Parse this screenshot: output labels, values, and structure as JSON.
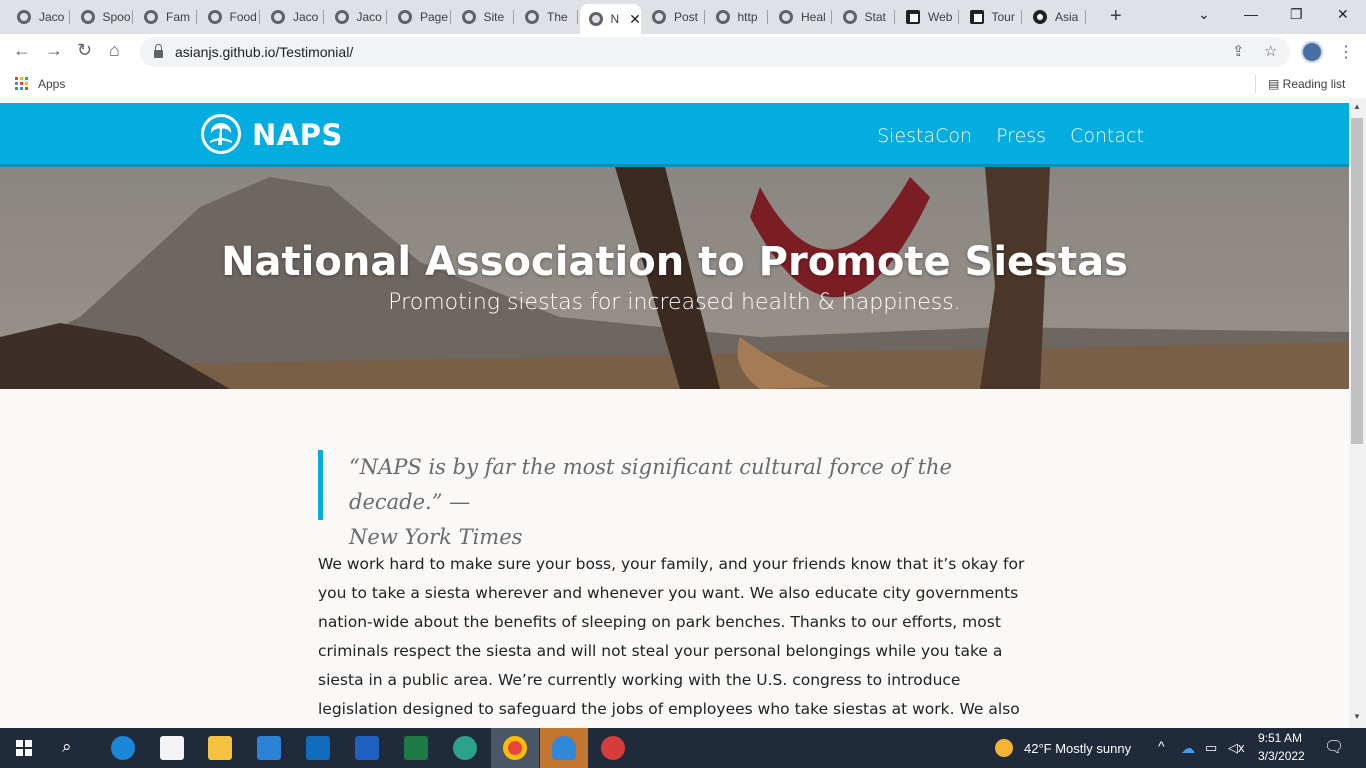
{
  "browser": {
    "tabs": [
      {
        "title": "Jaco",
        "icon": "globe-icon"
      },
      {
        "title": "Spoo",
        "icon": "globe-icon"
      },
      {
        "title": "Fam",
        "icon": "globe-icon"
      },
      {
        "title": "Food",
        "icon": "globe-icon"
      },
      {
        "title": "Jaco",
        "icon": "globe-icon"
      },
      {
        "title": "Jaco",
        "icon": "globe-icon"
      },
      {
        "title": "Page",
        "icon": "globe-icon"
      },
      {
        "title": "Site",
        "icon": "globe-icon"
      },
      {
        "title": "The",
        "icon": "globe-icon"
      },
      {
        "title": "N",
        "icon": "globe-icon",
        "active": true
      },
      {
        "title": "Post",
        "icon": "globe-icon"
      },
      {
        "title": "http",
        "icon": "globe-icon"
      },
      {
        "title": "Heal",
        "icon": "globe-icon"
      },
      {
        "title": "Stat",
        "icon": "globe-icon"
      },
      {
        "title": "Web",
        "icon": "box-icon"
      },
      {
        "title": "Tour",
        "icon": "box-icon"
      },
      {
        "title": "Asia",
        "icon": "github-icon"
      }
    ],
    "url": "asianjs.github.io/Testimonial/",
    "bookmarks": {
      "apps": "Apps",
      "reading_list": "Reading list"
    }
  },
  "site": {
    "logo": "NAPS",
    "nav": [
      "SiestaCon",
      "Press",
      "Contact"
    ],
    "hero_title": "National Association to Promote Siestas",
    "hero_subtitle": "Promoting siestas for increased health & happiness.",
    "quote_line1": "“NAPS is by far the most significant cultural force of the decade.” —",
    "quote_line2": "New York Times",
    "body": "We work hard to make sure your boss, your family, and your friends know that it’s okay for you to take a siesta wherever and whenever you want. We also educate city governments nation-wide about the benefits of sleeping on park benches. Thanks to our efforts, most criminals respect the siesta and will not steal your personal belongings while you take a siesta in a public area. We’re currently working with the U.S. congress to introduce legislation designed to safeguard the jobs of employees who take siestas at work. We also help fund many local chapter organizations. If",
    "colors": {
      "nav_bg": "#04ade0",
      "quote_border": "#04ade0",
      "page_bg": "#fbf9f7"
    }
  },
  "taskbar": {
    "weather": "42°F  Mostly sunny",
    "time": "9:51 AM",
    "date": "3/3/2022"
  }
}
